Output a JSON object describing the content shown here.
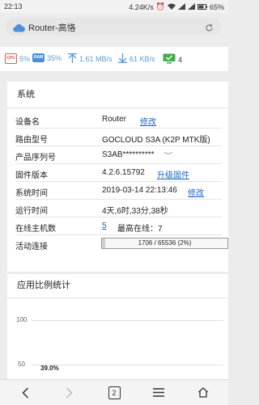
{
  "status_bar": {
    "time": "22:13",
    "speed": "4.24K/s",
    "battery": "65%"
  },
  "browser": {
    "page_title": "Router-高恪"
  },
  "metrics": {
    "cpu_label": "CPU",
    "cpu": "5%",
    "ram_label": "RAM",
    "ram": "35%",
    "upload": "1.61 MB/s",
    "download": "61 KB/s",
    "devices": "4"
  },
  "system": {
    "title": "系统",
    "rows": [
      {
        "label": "设备名",
        "value": "Router",
        "link": "修改"
      },
      {
        "label": "路由型号",
        "value": "GOCLOUD S3A (K2P MTK版)"
      },
      {
        "label": "产品序列号",
        "value": "S3AB**********"
      },
      {
        "label": "固件版本",
        "value": "4.2.6.15792",
        "link": "升级固件"
      },
      {
        "label": "系统时间",
        "value": "2019-03-14 22:13:46",
        "link": "修改"
      },
      {
        "label": "运行时间",
        "value": "4天,6时,33分,38秒"
      },
      {
        "label": "在线主机数",
        "value": "5",
        "extra": "最高在线：7"
      },
      {
        "label": "活动连接",
        "value": "1706 / 65536 (2%)"
      }
    ],
    "connections_fraction": 0.026
  },
  "usage": {
    "title": "应用比例统计",
    "ticks": [
      "100",
      "50"
    ],
    "data_label": "39.0%"
  },
  "nav": {
    "tabs": "2"
  },
  "colors": {
    "accent": "#5b9bd5",
    "link": "#1a66c9",
    "device_green": "#3fae49",
    "cpu_red": "#e05555"
  }
}
